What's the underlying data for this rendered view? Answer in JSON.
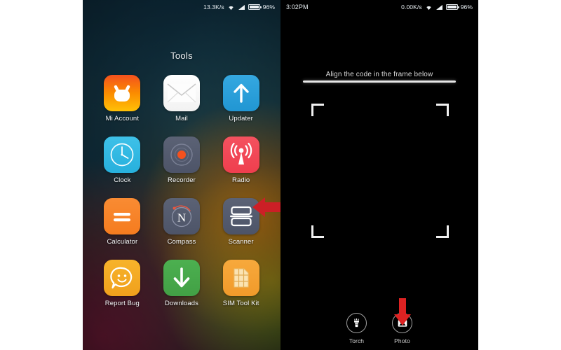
{
  "left_phone": {
    "status_bar": {
      "network_speed": "13.3K/s",
      "wifi_icon": "wifi-icon",
      "signal_icon": "signal-icon",
      "battery_icon": "battery-icon",
      "battery_percent": "96%"
    },
    "folder_title": "Tools",
    "apps": [
      {
        "label": "Mi Account",
        "icon": "mi-account-icon",
        "skin": "sk-miaccount"
      },
      {
        "label": "Mail",
        "icon": "mail-icon",
        "skin": "sk-mail"
      },
      {
        "label": "Updater",
        "icon": "updater-icon",
        "skin": "sk-updater"
      },
      {
        "label": "Clock",
        "icon": "clock-icon",
        "skin": "sk-clock"
      },
      {
        "label": "Recorder",
        "icon": "recorder-icon",
        "skin": "sk-recorder"
      },
      {
        "label": "Radio",
        "icon": "radio-icon",
        "skin": "sk-radio"
      },
      {
        "label": "Calculator",
        "icon": "calculator-icon",
        "skin": "sk-calculator"
      },
      {
        "label": "Compass",
        "icon": "compass-icon",
        "skin": "sk-compass"
      },
      {
        "label": "Scanner",
        "icon": "scanner-icon",
        "skin": "sk-scanner"
      },
      {
        "label": "Report Bug",
        "icon": "report-bug-icon",
        "skin": "sk-reportbug"
      },
      {
        "label": "Downloads",
        "icon": "downloads-icon",
        "skin": "sk-downloads"
      },
      {
        "label": "SIM Tool Kit",
        "icon": "sim-tool-kit-icon",
        "skin": "sk-simtoolkit"
      }
    ],
    "annotation_arrow": {
      "points_to": "Scanner",
      "direction": "left",
      "color": "#cc1f26"
    }
  },
  "right_phone": {
    "status_bar": {
      "time": "3:02PM",
      "network_speed": "0.00K/s",
      "wifi_icon": "wifi-icon",
      "signal_icon": "signal-icon",
      "battery_icon": "battery-icon",
      "battery_percent": "96%"
    },
    "scan_hint": "Align the code in the frame below",
    "viewfinder": {
      "corner_color": "#f0f0f0",
      "scanline_color": "#e6e6e6"
    },
    "bottom_tools": [
      {
        "label": "Torch",
        "icon": "torch-icon"
      },
      {
        "label": "Photo",
        "icon": "photo-icon"
      }
    ],
    "annotation_arrow": {
      "points_to": "Photo",
      "direction": "down",
      "color": "#dd2222"
    }
  }
}
